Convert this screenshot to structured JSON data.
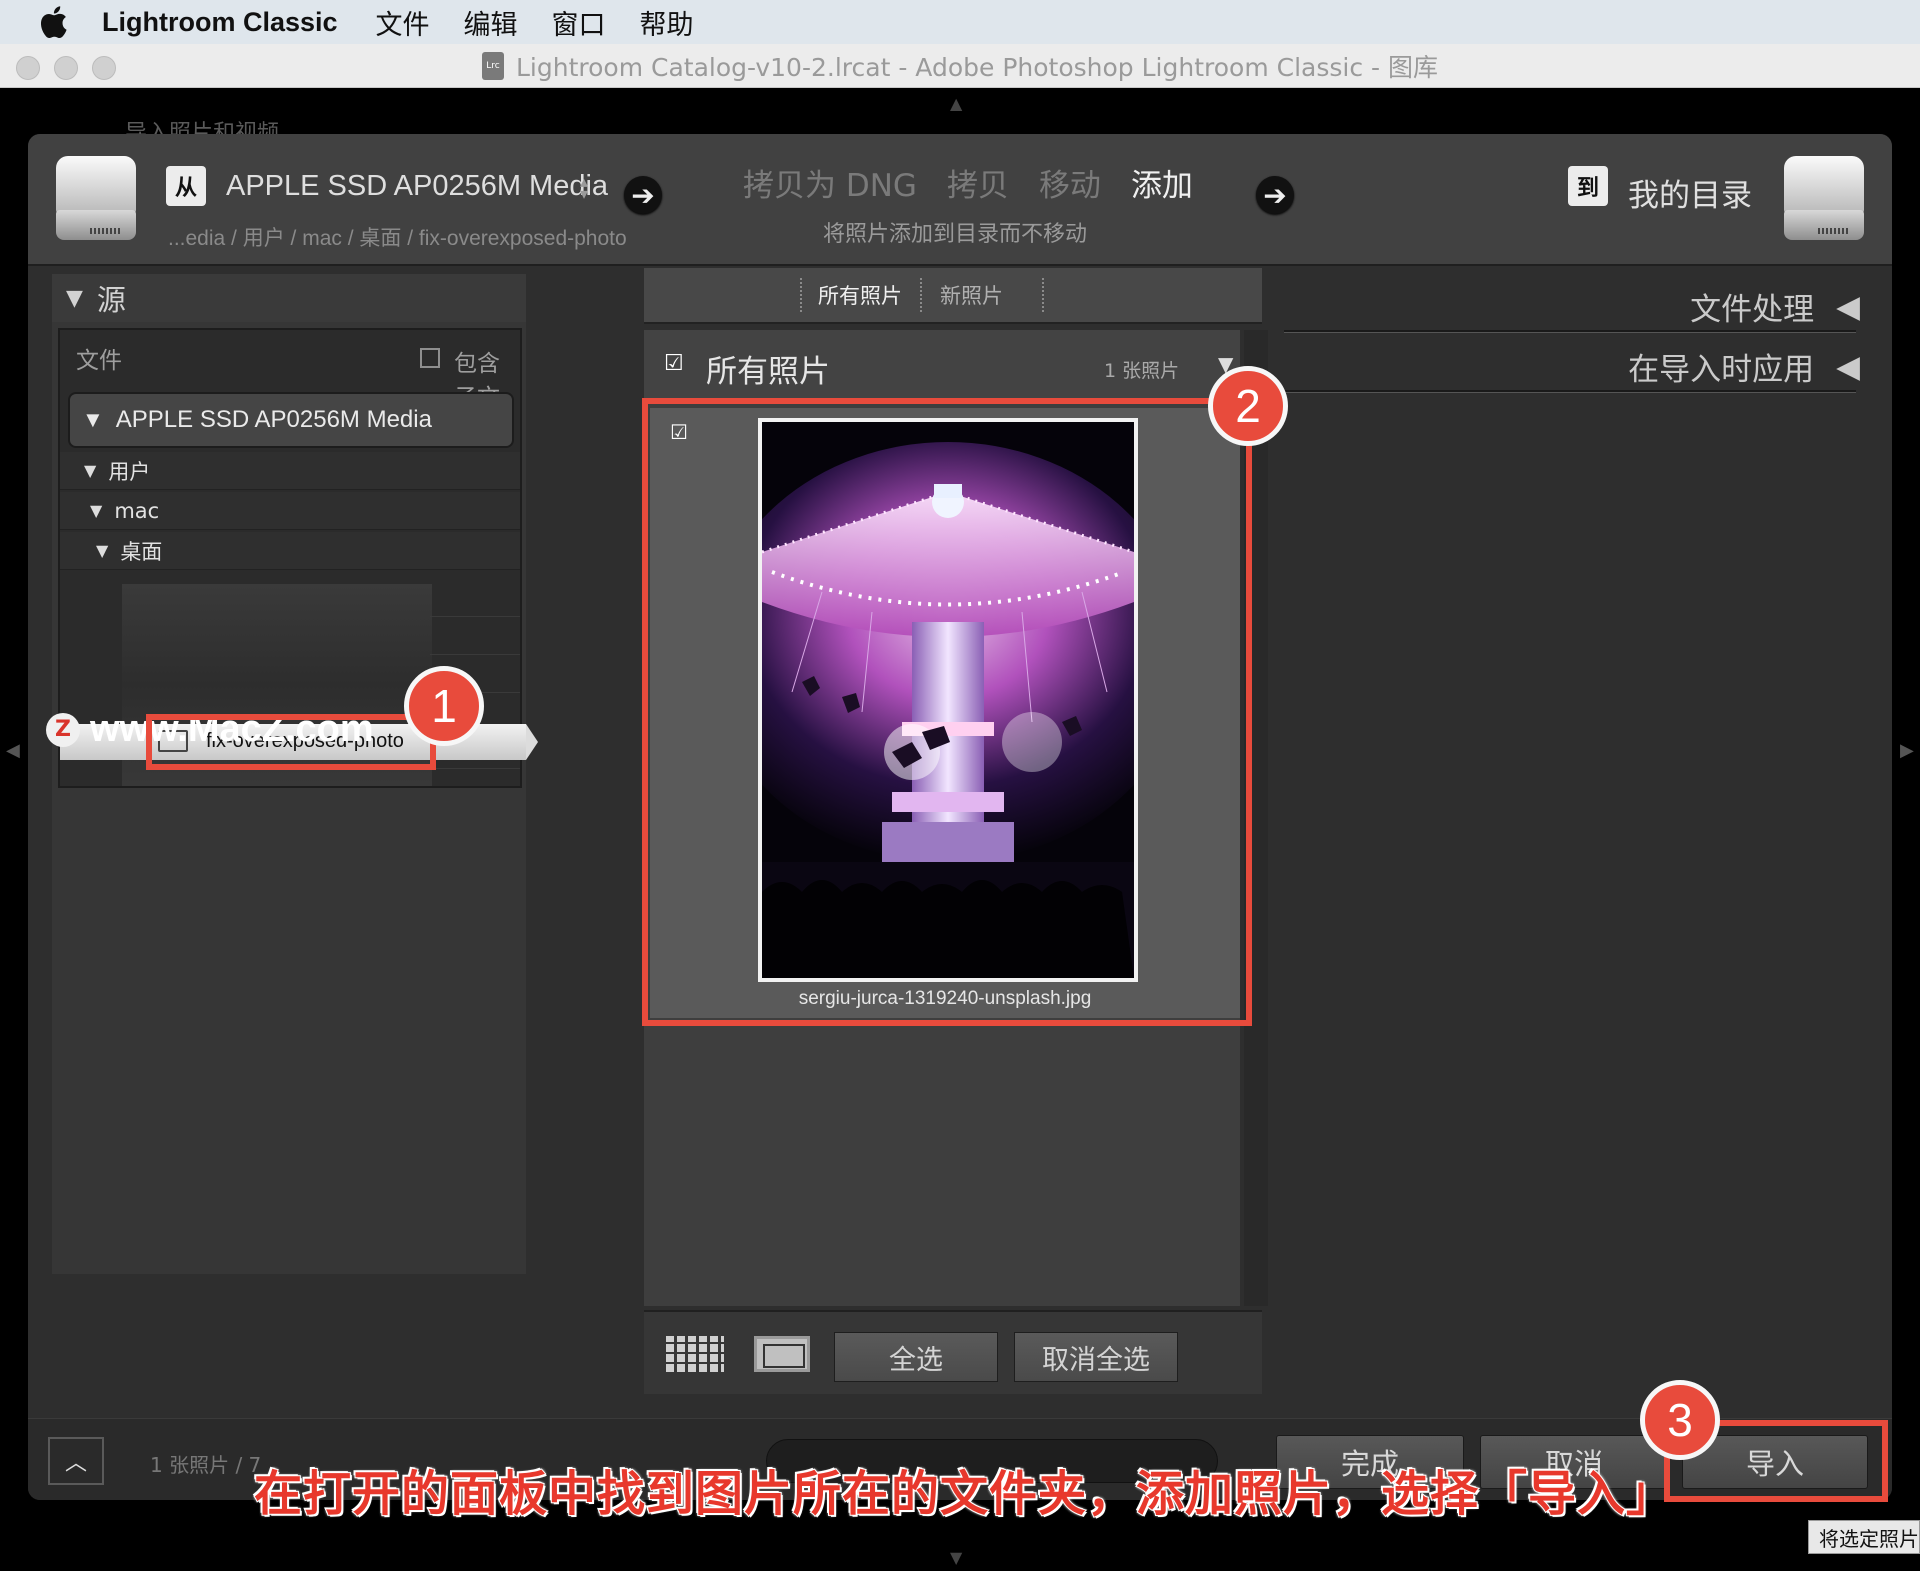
{
  "menubar": {
    "app_name": "Lightroom Classic",
    "items": [
      "文件",
      "编辑",
      "窗口",
      "帮助"
    ]
  },
  "titlebar": {
    "icon_text": "Lrc",
    "title": "Lightroom Catalog-v10-2.lrcat - Adobe Photoshop Lightroom Classic - 图库"
  },
  "background_text": "导入照片和视频",
  "header": {
    "source_badge": "从",
    "source_name": "APPLE SSD AP0256M Media",
    "source_path": "...edia / 用户 / mac / 桌面 / fix-overexposed-photo",
    "modes": [
      {
        "label": "拷贝为 DNG",
        "active": false
      },
      {
        "label": "拷贝",
        "active": false
      },
      {
        "label": "移动",
        "active": false
      },
      {
        "label": "添加",
        "active": true
      }
    ],
    "mode_description": "将照片添加到目录而不移动",
    "dest_badge": "到",
    "dest_name": "我的目录"
  },
  "source_panel": {
    "title": "源",
    "files_label": "文件",
    "include_subfolders": "包含子文件夹",
    "volume": "APPLE SSD AP0256M Media",
    "tree": [
      "用户",
      "mac",
      "桌面"
    ],
    "selected_folder": "fix-overexposed-photo"
  },
  "watermark": {
    "badge": "Z",
    "text": "www.MacZ.com"
  },
  "center": {
    "tabs": [
      "所有照片",
      "新照片"
    ],
    "grid_title": "所有照片",
    "photo_count": "1 张照片",
    "photo": {
      "filename": "sergiu-jurca-1319240-unsplash.jpg",
      "checked": true
    },
    "select_all": "全选",
    "deselect_all": "取消全选"
  },
  "right_panel": {
    "sections": [
      "文件处理",
      "在导入时应用"
    ]
  },
  "footer": {
    "count_text": "1 张照片 / 7",
    "done_button": "完成",
    "cancel_button": "取消",
    "import_button": "导入",
    "tooltip": "将选定照片"
  },
  "annotations": {
    "badges": [
      "1",
      "2",
      "3"
    ],
    "caption": "在打开的面板中找到图片所在的文件夹，添加照片，选择「导入」",
    "highlight_color": "#e84b3c"
  }
}
